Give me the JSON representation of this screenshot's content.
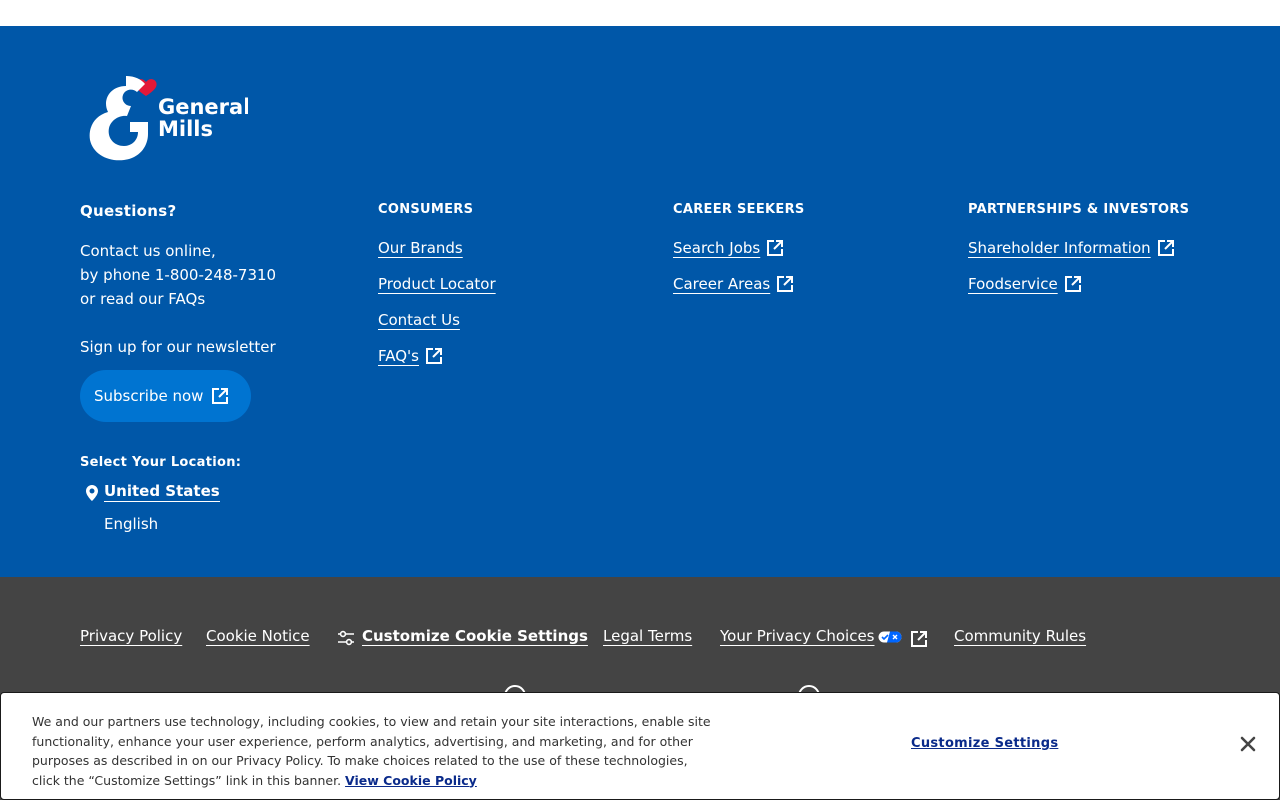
{
  "brand": {
    "logo_text_line1": "General",
    "logo_text_line2": "Mills"
  },
  "questions": {
    "heading": "Questions?",
    "line1": "Contact us online,",
    "line2": "by phone 1-800-248-7310",
    "line3": "or read our FAQs",
    "newsletter": "Sign up for our newsletter",
    "subscribe_label": "Subscribe now"
  },
  "consumers": {
    "heading": "CONSUMERS",
    "links": [
      "Our Brands",
      "Product Locator",
      "Contact Us",
      "FAQ's"
    ]
  },
  "career": {
    "heading": "CAREER SEEKERS",
    "links": [
      "Search Jobs",
      "Career Areas"
    ]
  },
  "partners": {
    "heading": "PARTNERSHIPS & INVESTORS",
    "links": [
      "Shareholder Information",
      "Foodservice"
    ]
  },
  "location": {
    "heading": "Select Your Location:",
    "country": "United States",
    "language": "English"
  },
  "legal": {
    "privacy": "Privacy Policy",
    "cookie_notice": "Cookie Notice",
    "customize": "Customize Cookie Settings",
    "legal_terms": "Legal Terms",
    "privacy_choices": "Your Privacy Choices",
    "community": "Community Rules"
  },
  "cookie_banner": {
    "text": "We and our partners use technology, including cookies, to view and retain your site interactions, enable site functionality, enhance your user experience, perform analytics, advertising, and marketing, and for other purposes as described in on our Privacy Policy. To make choices related to the use of these technologies, click the “Customize Settings” link in this banner.",
    "policy_link": "View Cookie Policy",
    "customize_button": "Customize Settings"
  },
  "colors": {
    "footer_blue": "#0057a8",
    "button_blue": "#0074d1",
    "dark_gray": "#444444",
    "heart_red": "#e31837"
  }
}
